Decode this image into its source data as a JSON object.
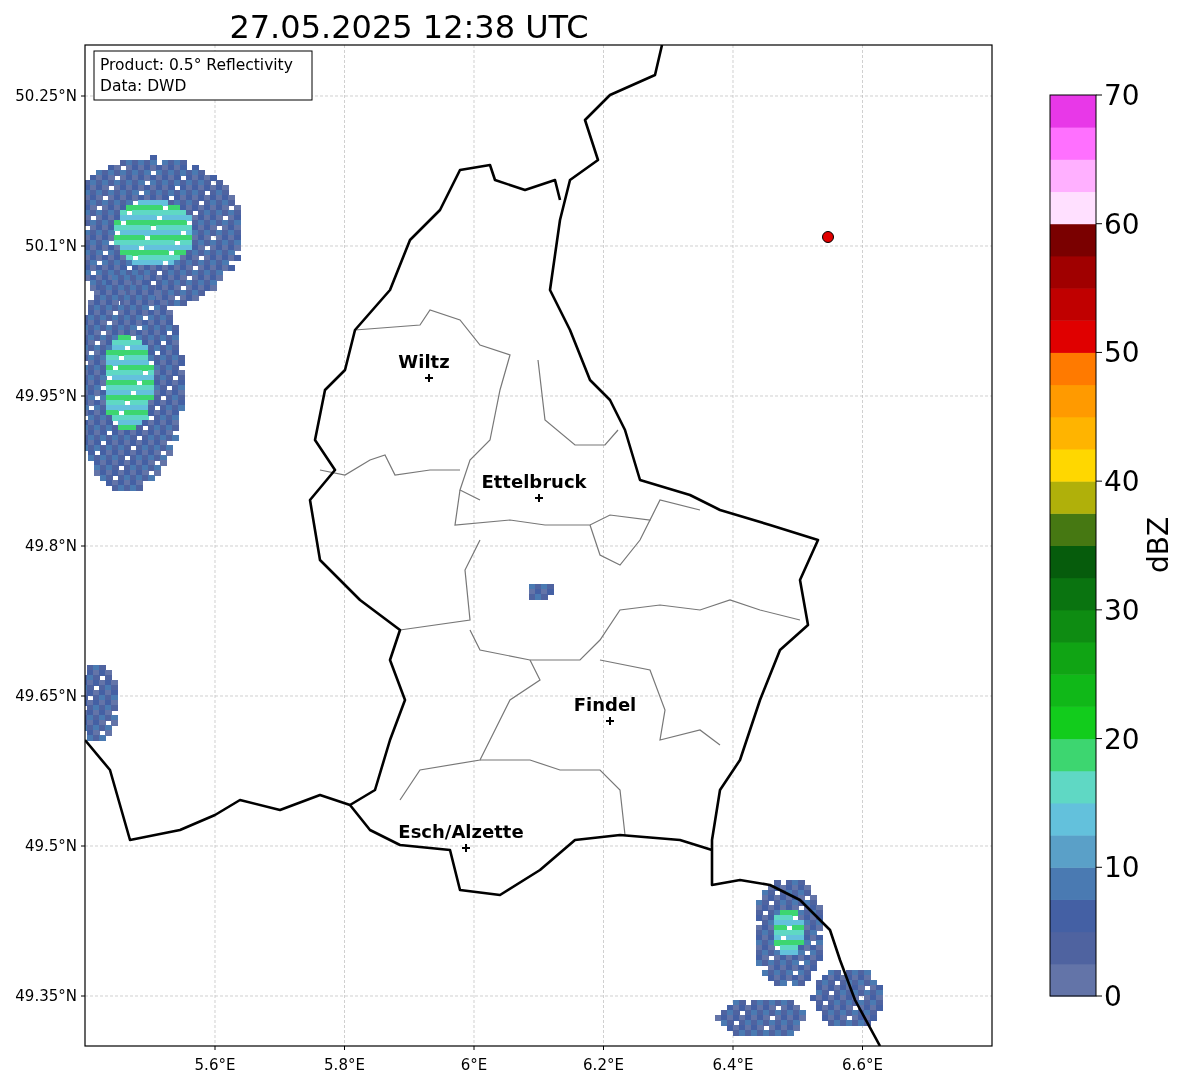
{
  "title": "27.05.2025 12:38 UTC",
  "info_box": [
    "Product: 0.5° Reflectivity",
    "Data: DWD"
  ],
  "y_ticks": [
    "50.25°N",
    "50.1°N",
    "49.95°N",
    "49.8°N",
    "49.65°N",
    "49.5°N",
    "49.35°N"
  ],
  "x_ticks": [
    "5.6°E",
    "5.8°E",
    "6°E",
    "6.2°E",
    "6.4°E",
    "6.6°E"
  ],
  "cities": [
    {
      "name": "Wiltz"
    },
    {
      "name": "Ettelbruck"
    },
    {
      "name": "Findel"
    },
    {
      "name": "Esch/Alzette"
    }
  ],
  "colorbar": {
    "label": "dBZ",
    "ticks": [
      "70",
      "60",
      "50",
      "40",
      "30",
      "20",
      "10",
      "0"
    ],
    "bands": [
      {
        "color": "#6374a8"
      },
      {
        "color": "#4f63a0"
      },
      {
        "color": "#4460a4"
      },
      {
        "color": "#4a7ab2"
      },
      {
        "color": "#5aa0c8"
      },
      {
        "color": "#63c1dc"
      },
      {
        "color": "#5fd8c4"
      },
      {
        "color": "#3dd670"
      },
      {
        "color": "#12cc1c"
      },
      {
        "color": "#10b818"
      },
      {
        "color": "#10a414"
      },
      {
        "color": "#0e8c12"
      },
      {
        "color": "#0a7410"
      },
      {
        "color": "#065c0c"
      },
      {
        "color": "#467812"
      },
      {
        "color": "#b0b00a"
      },
      {
        "color": "#ffd700"
      },
      {
        "color": "#ffb400"
      },
      {
        "color": "#ff9a00"
      },
      {
        "color": "#ff7a00"
      },
      {
        "color": "#e00000"
      },
      {
        "color": "#c00000"
      },
      {
        "color": "#a00000"
      },
      {
        "color": "#7a0000"
      },
      {
        "color": "#ffe0ff"
      },
      {
        "color": "#ffb0ff"
      },
      {
        "color": "#ff70ff"
      },
      {
        "color": "#e838e8"
      }
    ]
  }
}
